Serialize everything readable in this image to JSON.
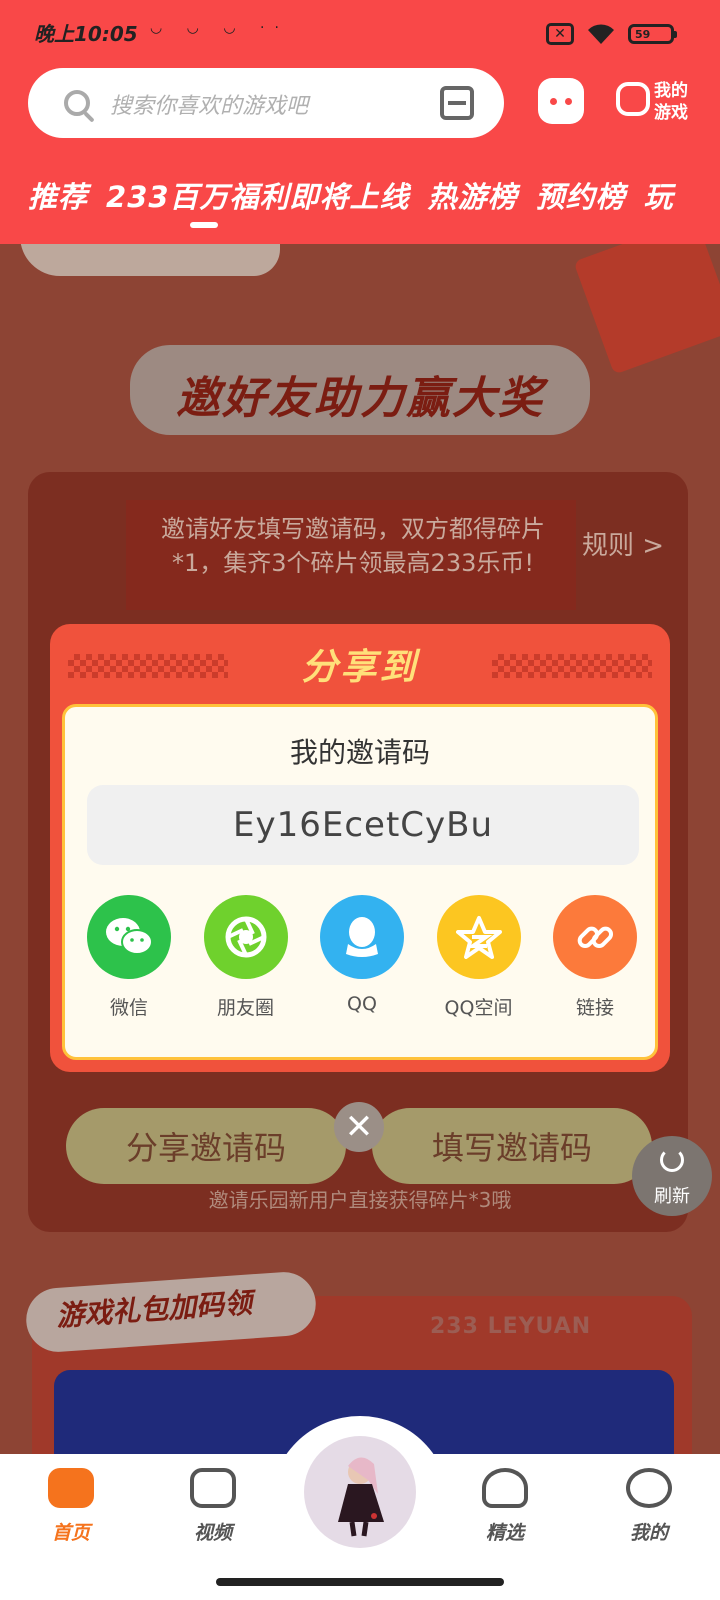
{
  "status_bar": {
    "time": "晚上10:05",
    "notification_icons": [
      "app-icon",
      "app-icon",
      "app-icon",
      "more-dots-icon"
    ],
    "battery": "59"
  },
  "header": {
    "search_placeholder": "搜索你喜欢的游戏吧",
    "my_games_label": "我的游戏",
    "tabs": [
      "推荐",
      "233百万福利即将上线",
      "热游榜",
      "预约榜",
      "玩"
    ],
    "active_tab": 0
  },
  "background": {
    "title": "邀好友助力赢大奖",
    "description": "邀请好友填写邀请码，双方都得碎片*1，集齐3个碎片领最高233乐币!",
    "rules": "规则 >",
    "share_code_button": "分享邀请码",
    "fill_code_button": "填写邀请码",
    "hint": "邀请乐园新用户直接获得碎片*3哦",
    "refresh": "刷新",
    "gift_title": "游戏礼包加码领",
    "brand": "233 LEYUAN"
  },
  "dialog": {
    "title": "分享到",
    "invite_label": "我的邀请码",
    "invite_code": "Ey16EcetCyBu",
    "share_targets": [
      {
        "label": "微信",
        "icon": "wechat-icon",
        "color": "#2dc24b"
      },
      {
        "label": "朋友圈",
        "icon": "moments-icon",
        "color": "#6fd12d"
      },
      {
        "label": "QQ",
        "icon": "qq-icon",
        "color": "#33b2f0"
      },
      {
        "label": "QQ空间",
        "icon": "qzone-icon",
        "color": "#fcc621"
      },
      {
        "label": "链接",
        "icon": "link-icon",
        "color": "#fc7a3b"
      }
    ]
  },
  "bottom_nav": {
    "items": [
      {
        "label": "首页",
        "icon": "gamepad-icon",
        "active": true
      },
      {
        "label": "视频",
        "icon": "video-icon",
        "active": false
      },
      {
        "label": "精选",
        "icon": "heart-icon",
        "active": false
      },
      {
        "label": "我的",
        "icon": "profile-icon",
        "active": false
      }
    ]
  },
  "colors": {
    "brand_red": "#f94848",
    "active_nav": "#f5731d"
  }
}
